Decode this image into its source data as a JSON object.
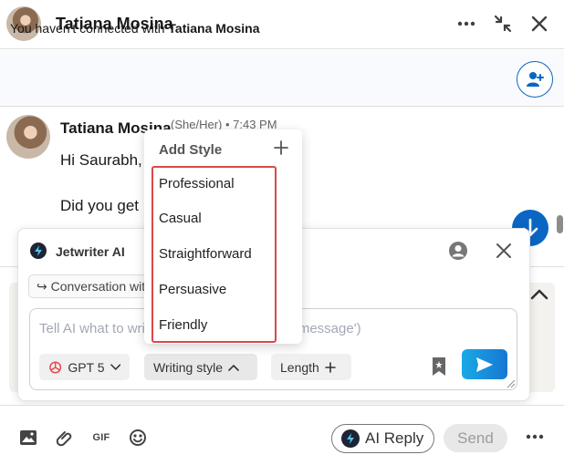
{
  "header": {
    "name": "Tatiana Mosina",
    "icons": [
      "more-icon",
      "minimize-icon",
      "close-icon"
    ]
  },
  "banner": {
    "text": "You haven't connected with",
    "name": "Tatiana Mosina"
  },
  "message": {
    "sender": "Tatiana Mosina",
    "meta": "(She/Her) • 7:43 PM",
    "line1": "Hi Saurabh,",
    "line2": "Did you get"
  },
  "jetwriter": {
    "title": "Jetwriter AI",
    "conversation_chip": "↪ Conversation with",
    "placeholder": "Tell AI what to write (e.g. 'Follow up on the message')",
    "model": "GPT 5",
    "writing_style": "Writing style",
    "length": "Length"
  },
  "style_menu": {
    "heading": "Add Style",
    "items": [
      "Professional",
      "Casual",
      "Straightforward",
      "Persuasive",
      "Friendly"
    ]
  },
  "footer": {
    "gif": "GIF",
    "ai_reply": "AI Reply",
    "send": "Send"
  },
  "colors": {
    "brand_blue": "#0a66c2",
    "highlight_red": "#d9484b",
    "send_gradient_start": "#1aa9e6"
  }
}
